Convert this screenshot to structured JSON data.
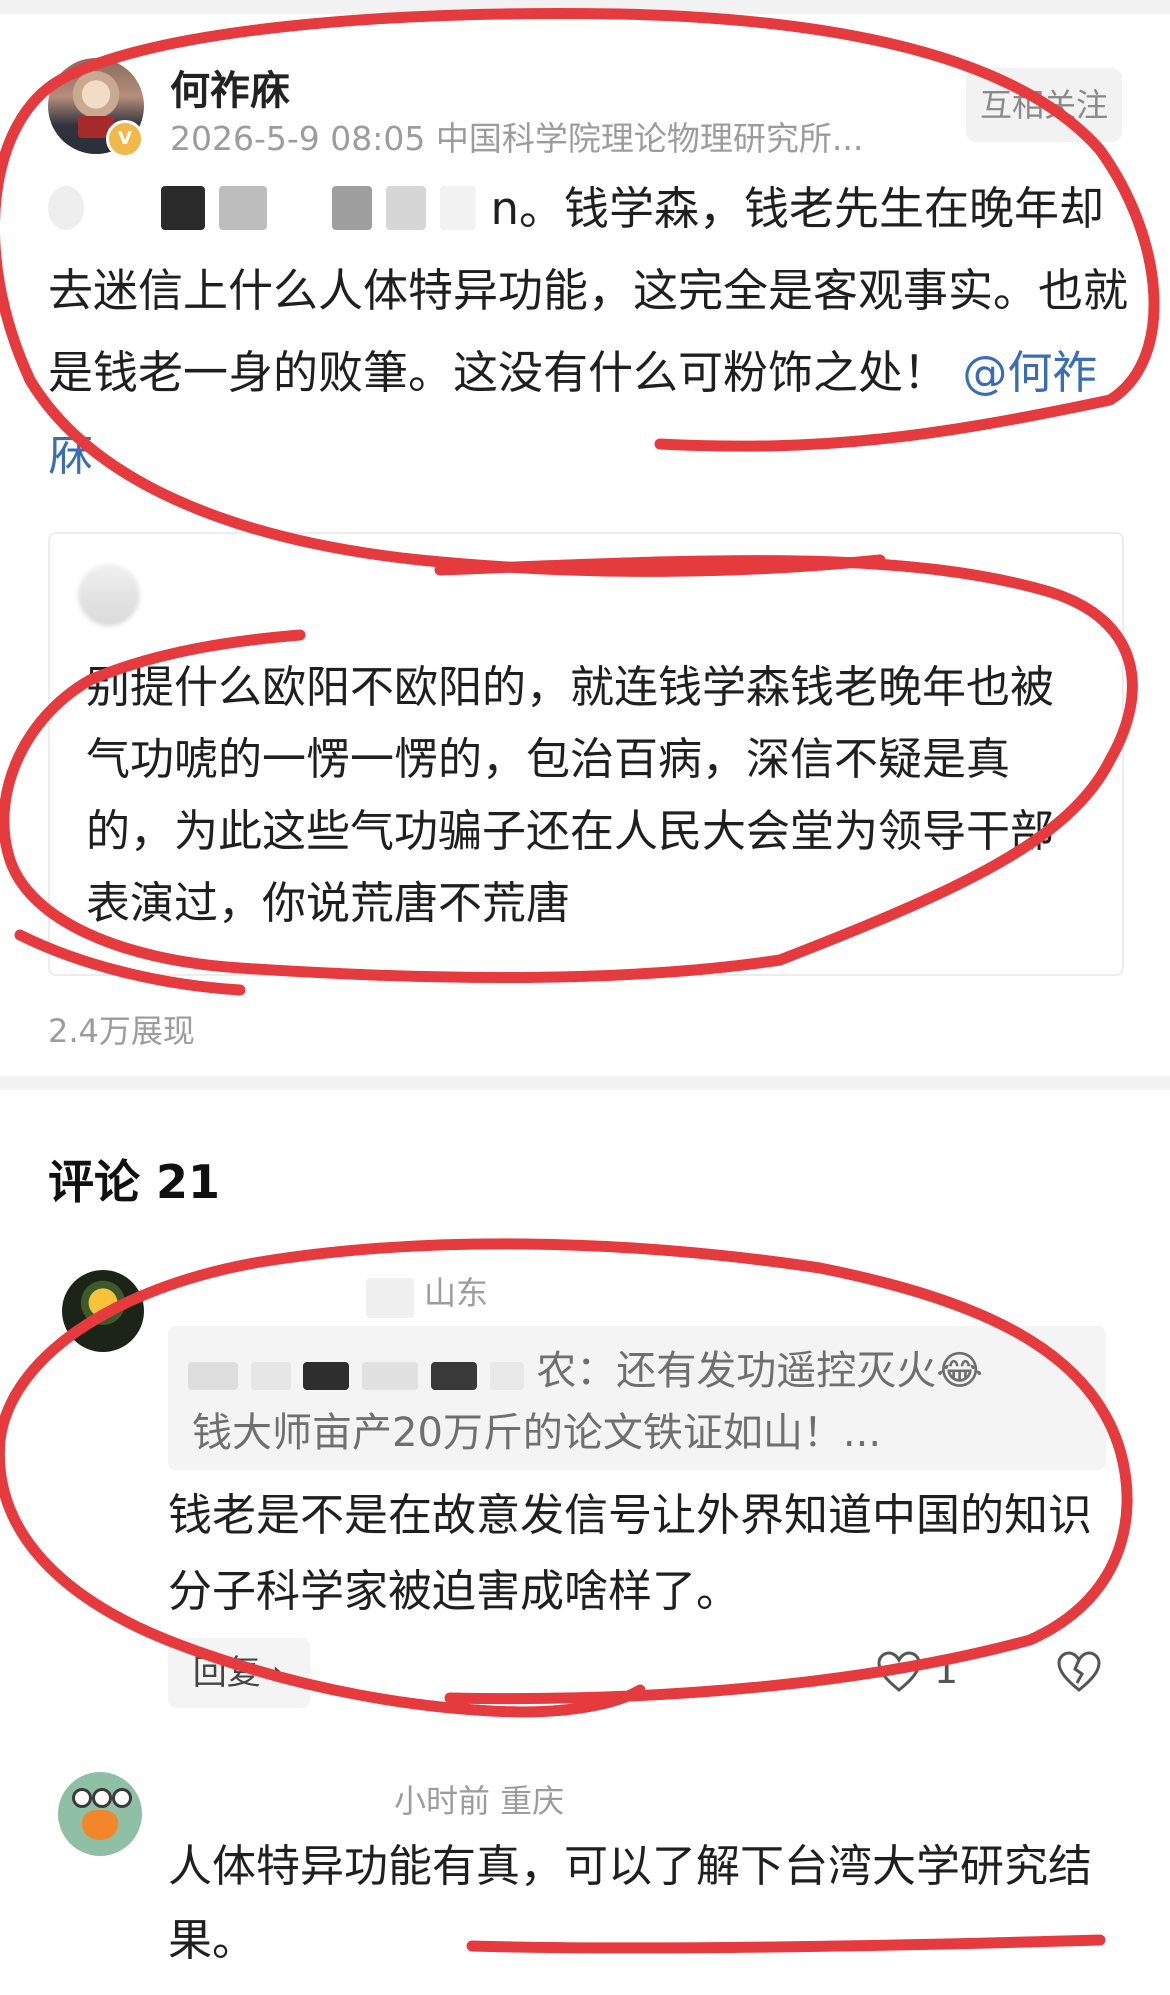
{
  "post": {
    "author_name": "何祚庥",
    "verified_badge": "V",
    "meta": "2026-5-9 08:05  中国科学院理论物理研究所...",
    "follow_label": "互相关注",
    "body_visible_start": "n。钱学森，钱老先生在晚年却去迷信上什么人体特异功能，这完全是客观事实。也就是钱老一身的败筆。这没有什么可粉饰之处！",
    "mention": "@何祚庥",
    "quote_text": "别提什么欧阳不欧阳的，就连钱学森钱老晚年也被气功唬的一愣一愣的，包治百病，深信不疑是真的，为此这些气功骗子还在人民大会堂为领导干部表演过，你说荒唐不荒唐",
    "impressions": "2.4万展现"
  },
  "comments": {
    "heading": "评论 21",
    "items": [
      {
        "meta_location": "山东",
        "reply_quote_line1": "农：还有发功遥控灭火😂",
        "reply_quote_line2": "钱大师亩产20万斤的论文铁证如山！...",
        "text": "钱老是不是在故意发信号让外界知道中国的知识分子科学家被迫害成啥样了。",
        "reply_label": "回复 ›",
        "like_count": "1"
      },
      {
        "meta": "小时前  重庆",
        "text": "人体特异功能有真，可以了解下台湾大学研究结果。"
      }
    ]
  },
  "icons": {
    "like": "heart-icon",
    "dislike": "broken-heart-icon",
    "verified": "verified-v-icon"
  },
  "colors": {
    "mention": "#3b6db3",
    "annotation_ink": "#e63b3e",
    "badge": "#f1b84b"
  }
}
